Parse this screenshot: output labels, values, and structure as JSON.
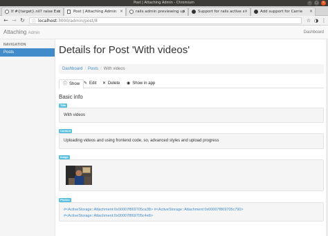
{
  "window": {
    "title": "Post | Attaching Admin - Chromium"
  },
  "browser_tabs": [
    {
      "label": "If #{target}.nil? raise Exc",
      "icon": "globe-icon"
    },
    {
      "label": "Post | Attaching Admin",
      "icon": "page-icon"
    },
    {
      "label": "rails admin previewing up",
      "icon": "globe-icon"
    },
    {
      "label": "Support for rails active s",
      "icon": "github-icon"
    },
    {
      "label": "Add support for Carrie",
      "icon": "github-icon"
    }
  ],
  "address": {
    "host": "localhost",
    "path": ":3000/admin/post/8"
  },
  "app": {
    "brand": "Attaching",
    "brand_small": "Admin",
    "dashboard": "Dashboard"
  },
  "sidebar": {
    "heading": "NAVIGATION",
    "items": [
      "Posts"
    ]
  },
  "page": {
    "title": "Details for Post 'With videos'",
    "breadcrumb": [
      "Dashboard",
      "Posts",
      "With videos"
    ],
    "tabs": [
      {
        "label": "Show",
        "icon": "info-icon"
      },
      {
        "label": "Edit",
        "icon": "pencil-icon"
      },
      {
        "label": "Delete",
        "icon": "remove-icon"
      },
      {
        "label": "Show in app",
        "icon": "eye-icon"
      }
    ],
    "section": "Basic info"
  },
  "fields": {
    "title": {
      "label": "Title",
      "value": "With videos"
    },
    "content": {
      "label": "Content",
      "value": "Uploading videos and using frontend code, so, advanced styles and upload progress"
    },
    "image": {
      "label": "Image"
    },
    "photos": {
      "label": "Photos",
      "line1": "#<ActiveStorage::Attachment:0x00007f869705ca38> #<ActiveStorage::Attachment:0x00007f869705c790>",
      "line2": "#<ActiveStorage::Attachment:0x00007f869705c4e8>"
    }
  },
  "colors": {
    "primary": "#428bca",
    "label_info": "#5bc0de",
    "titlebar": "#3c3b37"
  }
}
